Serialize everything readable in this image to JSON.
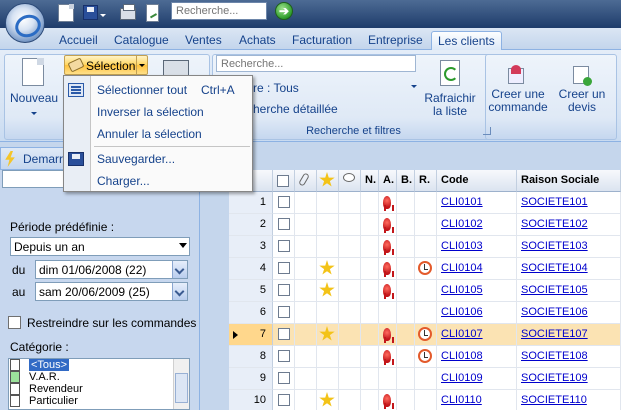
{
  "quick_access": {
    "search_placeholder": "Recherche...",
    "go_label": "➔"
  },
  "tabs": [
    {
      "label": "Accueil",
      "active": false
    },
    {
      "label": "Catalogue",
      "active": false
    },
    {
      "label": "Ventes",
      "active": false
    },
    {
      "label": "Achats",
      "active": false
    },
    {
      "label": "Facturation",
      "active": false
    },
    {
      "label": "Entreprise",
      "active": false
    },
    {
      "label": "Les clients",
      "active": true
    }
  ],
  "ribbon": {
    "nouveau_label": "Nouveau",
    "selection_label": "Sélection",
    "search_placeholder": "Recherche...",
    "filter_label": "re : Tous",
    "search_detail_label": "herche détaillée",
    "search_group_label": "Recherche et filtres",
    "refresh_label_1": "Rafraichir",
    "refresh_label_2": "la liste",
    "create_order_label_1": "Creer une",
    "create_order_label_2": "commande",
    "create_quote_label_1": "Creer un",
    "create_quote_label_2": "devis"
  },
  "selection_menu": {
    "items": [
      {
        "label": "Sélectionner tout",
        "shortcut": "Ctrl+A",
        "icon": "list-icon"
      },
      {
        "label": "Inverser la sélection",
        "shortcut": "",
        "icon": ""
      },
      {
        "label": "Annuler la sélection",
        "shortcut": "",
        "icon": ""
      },
      {
        "label": "Sauvegarder...",
        "shortcut": "",
        "icon": "save-icon"
      },
      {
        "label": "Charger...",
        "shortcut": "",
        "icon": ""
      }
    ]
  },
  "left_panel": {
    "demarrer_label": "Demarrer",
    "periode_label": "Période prédéfinie :",
    "periode_value": "Depuis un an",
    "du_label": "du",
    "du_value": "dim  01/06/2008  (22)",
    "au_label": "au",
    "au_value": "sam 20/06/2009  (25)",
    "restreindre_label": "Restreindre sur les commandes",
    "categorie_label": "Catégorie :",
    "categories": [
      {
        "label": "<Tous>",
        "color": "#ffffff",
        "selected": true
      },
      {
        "label": "V.A.R.",
        "color": "#9be39b",
        "selected": false
      },
      {
        "label": "Revendeur",
        "color": "#ffffff",
        "selected": false
      },
      {
        "label": "Particulier",
        "color": "#ffffff",
        "selected": false
      }
    ]
  },
  "grid": {
    "headers": {
      "n": "N.",
      "a": "A.",
      "b": "B.",
      "r": "R.",
      "code": "Code",
      "raison": "Raison Sociale"
    },
    "rows": [
      {
        "num": "1",
        "star": false,
        "a": true,
        "r": false,
        "code": "CLI0101",
        "raison": "SOCIETE101",
        "current": false
      },
      {
        "num": "2",
        "star": false,
        "a": true,
        "r": false,
        "code": "CLI0102",
        "raison": "SOCIETE102",
        "current": false
      },
      {
        "num": "3",
        "star": false,
        "a": true,
        "r": false,
        "code": "CLI0103",
        "raison": "SOCIETE103",
        "current": false
      },
      {
        "num": "4",
        "star": true,
        "a": true,
        "r": true,
        "code": "CLI0104",
        "raison": "SOCIETE104",
        "current": false
      },
      {
        "num": "5",
        "star": true,
        "a": true,
        "r": false,
        "code": "CLI0105",
        "raison": "SOCIETE105",
        "current": false
      },
      {
        "num": "6",
        "star": false,
        "a": false,
        "r": false,
        "code": "CLI0106",
        "raison": "SOCIETE106",
        "current": false
      },
      {
        "num": "7",
        "star": true,
        "a": true,
        "r": true,
        "code": "CLI0107",
        "raison": "SOCIETE107",
        "current": true
      },
      {
        "num": "8",
        "star": false,
        "a": true,
        "r": true,
        "code": "CLI0108",
        "raison": "SOCIETE108",
        "current": false
      },
      {
        "num": "9",
        "star": false,
        "a": false,
        "r": false,
        "code": "CLI0109",
        "raison": "SOCIETE109",
        "current": false
      },
      {
        "num": "10",
        "star": true,
        "a": true,
        "r": false,
        "code": "CLI0110",
        "raison": "SOCIETE110",
        "current": false
      }
    ]
  }
}
